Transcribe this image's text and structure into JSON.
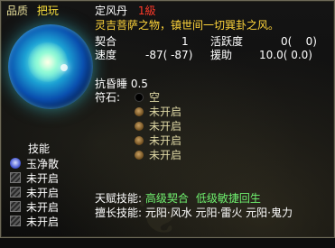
{
  "item": {
    "quality_label": "品质",
    "quality_value": "把玩",
    "name": "定风丹",
    "level": "1級",
    "description": "灵吉菩萨之物，镇世间一切巽卦之风。"
  },
  "stats": [
    {
      "label": "契合",
      "value": "1",
      "label2": "活跃度",
      "value2": "0(    0)"
    },
    {
      "label": "速度",
      "value": "-87( -87)",
      "label2": "援助",
      "value2": "10.0( 0.0)"
    }
  ],
  "resist": "抗昏睡 0.5",
  "runes": {
    "label": "符石:",
    "slots": [
      {
        "text": "空",
        "state": "empty"
      },
      {
        "text": "未开启",
        "state": "locked"
      },
      {
        "text": "未开启",
        "state": "locked"
      },
      {
        "text": "未开启",
        "state": "locked"
      },
      {
        "text": "未开启",
        "state": "locked"
      }
    ]
  },
  "skills": {
    "title": "技能",
    "items": [
      {
        "name": "玉净散",
        "state": "active"
      },
      {
        "name": "未开启",
        "state": "locked"
      },
      {
        "name": "未开启",
        "state": "locked"
      },
      {
        "name": "未开启",
        "state": "locked"
      },
      {
        "name": "未开启",
        "state": "locked"
      }
    ]
  },
  "talent": {
    "label": "天赋技能:",
    "values": [
      "高级契合",
      "低级敏捷回生"
    ]
  },
  "expertise": {
    "label": "擅长技能:",
    "value": "元阳·风水 元阳·雷火 元阳·鬼力"
  },
  "colors": {
    "quality": "#ffe23a",
    "level": "#ff3a2a",
    "description": "#ffd53b",
    "talent": "#6ff06f"
  }
}
